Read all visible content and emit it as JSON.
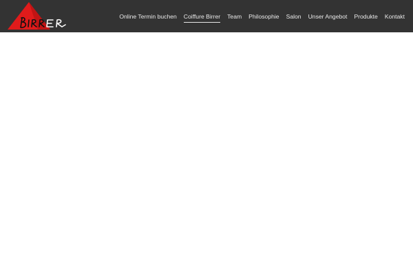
{
  "header": {
    "logo": {
      "text": "BIRRER",
      "icon": "red-triangle-logo-icon",
      "colors": {
        "triangle": "#e01b1b",
        "triangle_dark": "#a80f0f",
        "text": "#111111"
      }
    },
    "background": "#333333",
    "nav": [
      {
        "label": "Online Termin buchen",
        "active": false
      },
      {
        "label": "Coiffure Birrer",
        "active": true
      },
      {
        "label": "Team",
        "active": false
      },
      {
        "label": "Philosophie",
        "active": false
      },
      {
        "label": "Salon",
        "active": false
      },
      {
        "label": "Unser Angebot",
        "active": false
      },
      {
        "label": "Produkte",
        "active": false
      },
      {
        "label": "Kontakt",
        "active": false
      }
    ]
  }
}
